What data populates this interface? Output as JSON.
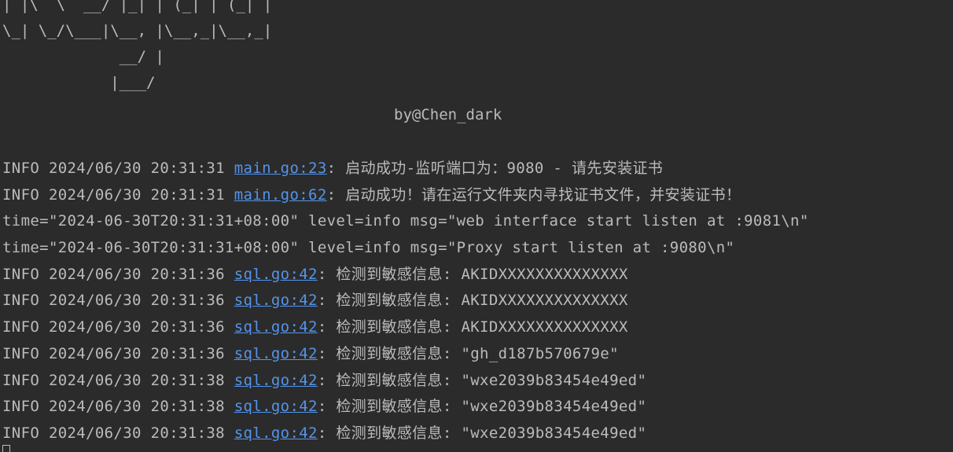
{
  "banner": {
    "ascii": "| |\\  \\  __/ |_| | (_| | (_| |\n\\_| \\_/\\___|\\__, |\\__,_|\\__,_|\n             __/ |\n            |___/",
    "author": "by@Chen_dark"
  },
  "logs": [
    {
      "prefix": "INFO 2024/06/30 20:31:31 ",
      "link": "main.go:23",
      "message": ": 启动成功-监听端口为：9080 - 请先安装证书"
    },
    {
      "prefix": "INFO 2024/06/30 20:31:31 ",
      "link": "main.go:62",
      "message": ": 启动成功！请在运行文件夹内寻找证书文件，并安装证书！"
    },
    {
      "text": "time=\"2024-06-30T20:31:31+08:00\" level=info msg=\"web interface start listen at :9081\\n\""
    },
    {
      "text": "time=\"2024-06-30T20:31:31+08:00\" level=info msg=\"Proxy start listen at :9080\\n\""
    },
    {
      "prefix": "INFO 2024/06/30 20:31:36 ",
      "link": "sql.go:42",
      "message": ": 检测到敏感信息: AKIDXXXXXXXXXXXXXX"
    },
    {
      "prefix": "INFO 2024/06/30 20:31:36 ",
      "link": "sql.go:42",
      "message": ": 检测到敏感信息: AKIDXXXXXXXXXXXXXX"
    },
    {
      "prefix": "INFO 2024/06/30 20:31:36 ",
      "link": "sql.go:42",
      "message": ": 检测到敏感信息: AKIDXXXXXXXXXXXXXX"
    },
    {
      "prefix": "INFO 2024/06/30 20:31:36 ",
      "link": "sql.go:42",
      "message": ": 检测到敏感信息: \"gh_d187b570679e\""
    },
    {
      "prefix": "INFO 2024/06/30 20:31:38 ",
      "link": "sql.go:42",
      "message": ": 检测到敏感信息: \"wxe2039b83454e49ed\""
    },
    {
      "prefix": "INFO 2024/06/30 20:31:38 ",
      "link": "sql.go:42",
      "message": ": 检测到敏感信息: \"wxe2039b83454e49ed\""
    },
    {
      "prefix": "INFO 2024/06/30 20:31:38 ",
      "link": "sql.go:42",
      "message": ": 检测到敏感信息: \"wxe2039b83454e49ed\""
    }
  ],
  "colors": {
    "background": "#2b2b2b",
    "text": "#bbbbbb",
    "link": "#5394ec"
  }
}
